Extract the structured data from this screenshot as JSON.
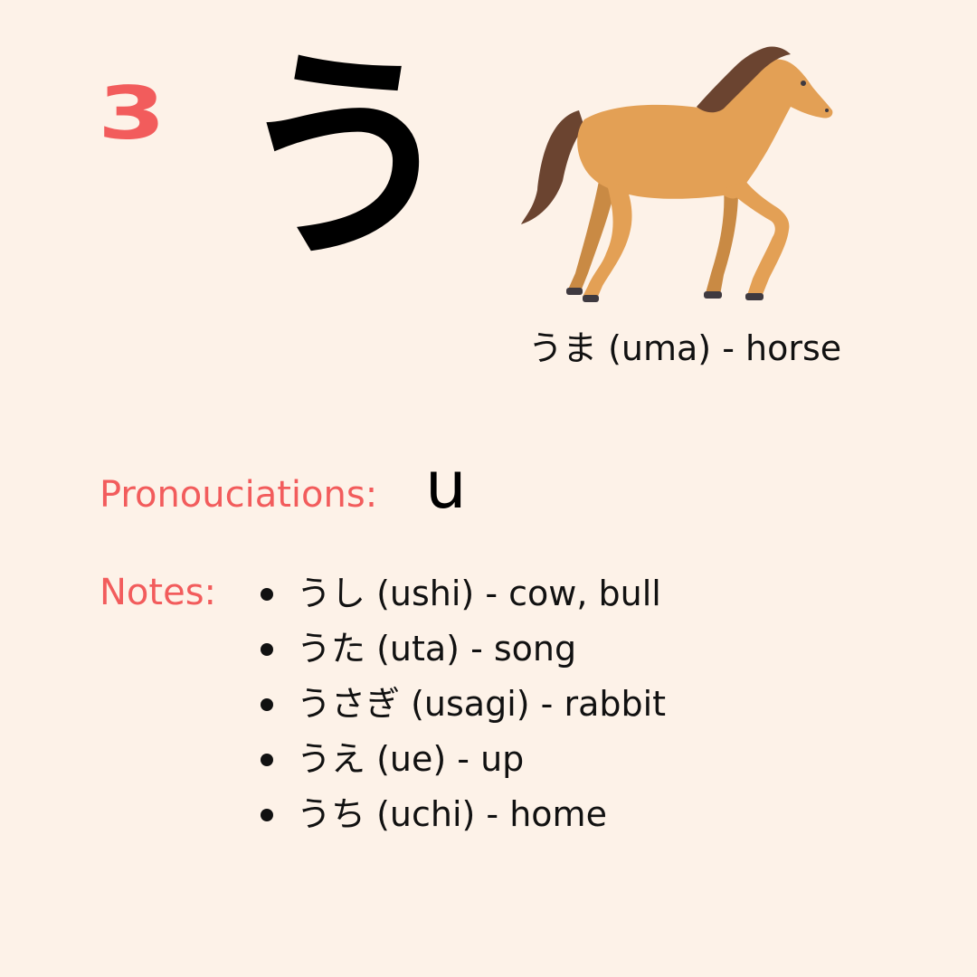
{
  "card": {
    "number": "3",
    "kana": "う",
    "example_word": "うま (uma) - horse",
    "pronunciation_label": "Pronouciations:",
    "pronunciation_value": "u",
    "notes_label": "Notes:",
    "notes": [
      "うし (ushi) - cow, bull",
      "うた (uta) - song",
      "うさぎ (usagi) - rabbit",
      "うえ (ue) - up",
      "うち (uchi) - home"
    ]
  },
  "colors": {
    "background": "#fdf2e8",
    "accent": "#f25c5c",
    "horse_body": "#e3a055",
    "horse_mane": "#6b4430"
  },
  "icons": {
    "illustration": "horse-icon"
  }
}
